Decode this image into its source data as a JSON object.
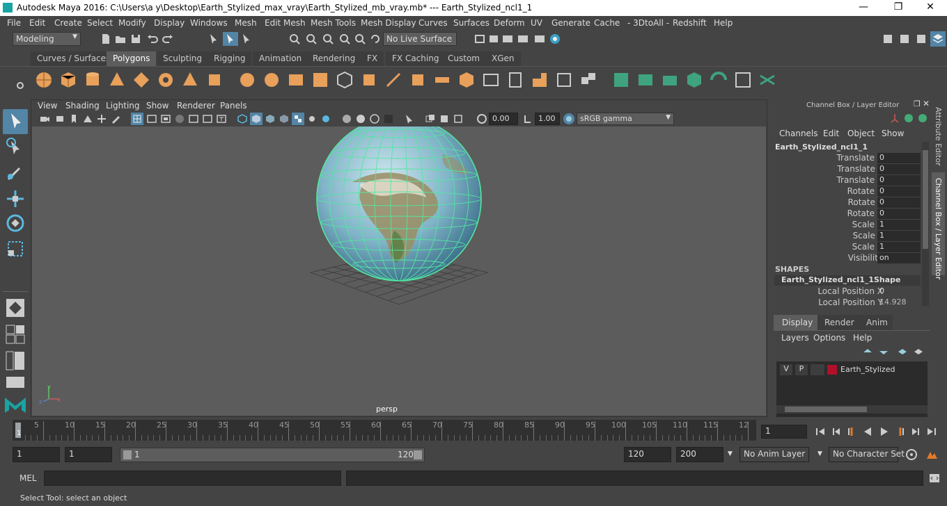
{
  "window": {
    "title": "Autodesk Maya 2016: C:\\Users\\a y\\Desktop\\Earth_Stylized_max_vray\\Earth_Stylized_mb_vray.mb*   ---   Earth_Stylized_ncl1_1",
    "minimize": "—",
    "maximize": "❐",
    "close": "✕"
  },
  "menu": [
    "File",
    "Edit",
    "Create",
    "Select",
    "Modify",
    "Display",
    "Windows",
    "Mesh",
    "Edit Mesh",
    "Mesh Tools",
    "Mesh Display",
    "Curves",
    "Surfaces",
    "Deform",
    "UV",
    "Generate",
    "Cache",
    "- 3DtoAll -",
    "Redshift",
    "Help"
  ],
  "status": {
    "mode": "Modeling",
    "live_surface": "No Live Surface"
  },
  "shelf_tabs": [
    "Curves / Surfaces",
    "Polygons",
    "Sculpting",
    "Rigging",
    "Animation",
    "Rendering",
    "FX",
    "FX Caching",
    "Custom",
    "XGen"
  ],
  "shelf_active": "Polygons",
  "viewport": {
    "menu": [
      "View",
      "Shading",
      "Lighting",
      "Show",
      "Renderer",
      "Panels"
    ],
    "exposure": "0.00",
    "gamma": "1.00",
    "color_space": "sRGB gamma",
    "camera": "persp"
  },
  "channel_box": {
    "header": "Channel Box / Layer Editor",
    "menu": [
      "Channels",
      "Edit",
      "Object",
      "Show"
    ],
    "object": "Earth_Stylized_ncl1_1",
    "attributes": [
      {
        "label": "Translate X",
        "value": "0"
      },
      {
        "label": "Translate Y",
        "value": "0"
      },
      {
        "label": "Translate Z",
        "value": "0"
      },
      {
        "label": "Rotate X",
        "value": "0"
      },
      {
        "label": "Rotate Y",
        "value": "0"
      },
      {
        "label": "Rotate Z",
        "value": "0"
      },
      {
        "label": "Scale X",
        "value": "1"
      },
      {
        "label": "Scale Y",
        "value": "1"
      },
      {
        "label": "Scale Z",
        "value": "1"
      },
      {
        "label": "Visibility",
        "value": "on"
      }
    ],
    "shapes_label": "SHAPES",
    "shape_name": "Earth_Stylized_ncl1_1Shape",
    "shape_attributes": [
      {
        "label": "Local Position X",
        "value": "0"
      },
      {
        "label": "Local Position Y",
        "value": "14.928"
      }
    ]
  },
  "side_tabs": [
    "Attribute Editor",
    "Channel Box / Layer Editor"
  ],
  "layer_editor": {
    "tabs": [
      "Display",
      "Render",
      "Anim"
    ],
    "active_tab": "Display",
    "menu": [
      "Layers",
      "Options",
      "Help"
    ],
    "layer": {
      "v": "V",
      "p": "P",
      "name": "Earth_Stylized",
      "color": "#b0102a"
    }
  },
  "timeline": {
    "ticks": [
      "5",
      "10",
      "15",
      "20",
      "25",
      "30",
      "35",
      "40",
      "45",
      "50",
      "55",
      "60",
      "65",
      "70",
      "75",
      "80",
      "85",
      "90",
      "95",
      "100",
      "105",
      "110",
      "115",
      "12"
    ],
    "start_marker": "1",
    "current_frame": "1"
  },
  "range": {
    "start": "1",
    "playback_start": "1",
    "slider_start": "1",
    "slider_end": "120",
    "playback_end": "120",
    "end": "200",
    "anim_layer": "No Anim Layer",
    "character_set": "No Character Set"
  },
  "mel": {
    "label": "MEL"
  },
  "help_line": "Select Tool: select an object",
  "colors": {
    "accent": "#5285a6",
    "wire": "#53e6a0",
    "shelf_icon": "#e8a05a",
    "shelf_icon_green": "#3fa37f"
  }
}
